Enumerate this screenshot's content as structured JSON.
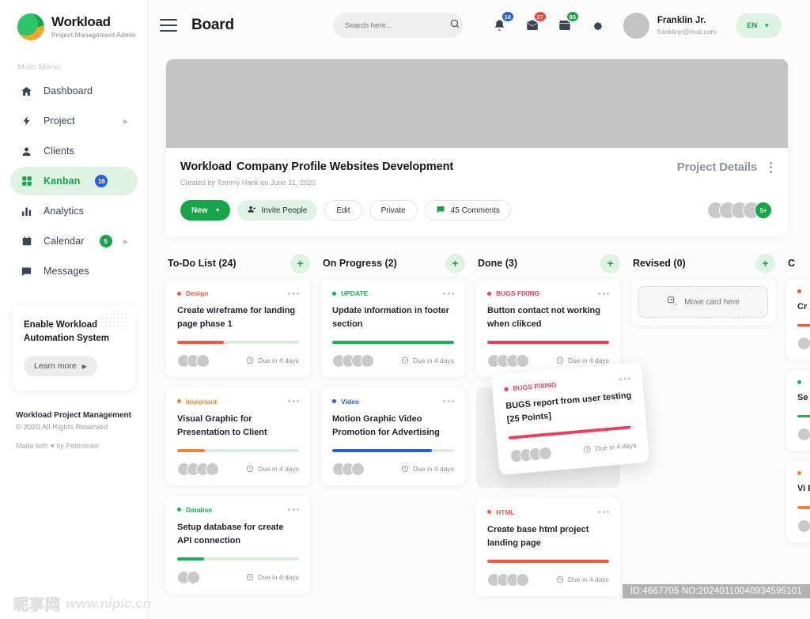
{
  "sidebar": {
    "brand": {
      "title": "Workload",
      "subtitle": "Project Management Admin",
      "logo_icon": "workload-logo"
    },
    "menu_label": "Main Menu",
    "items": [
      {
        "label": "Dashboard",
        "icon": "home-icon",
        "badge": null,
        "badge_color": null,
        "caret": false,
        "active": false
      },
      {
        "label": "Project",
        "icon": "bolt-icon",
        "badge": null,
        "badge_color": null,
        "caret": true,
        "active": false
      },
      {
        "label": "Clients",
        "icon": "user-icon",
        "badge": null,
        "badge_color": null,
        "caret": false,
        "active": false
      },
      {
        "label": "Kanban",
        "icon": "grid-icon",
        "badge": "16",
        "badge_color": "#2a5ed8",
        "caret": false,
        "active": true
      },
      {
        "label": "Analytics",
        "icon": "chart-icon",
        "badge": null,
        "badge_color": null,
        "caret": false,
        "active": false
      },
      {
        "label": "Calendar",
        "icon": "calendar-icon",
        "badge": "5",
        "badge_color": "#17a44a",
        "caret": true,
        "active": false
      },
      {
        "label": "Messages",
        "icon": "message-icon",
        "badge": null,
        "badge_color": null,
        "caret": false,
        "active": false
      }
    ],
    "promo": {
      "title": "Enable Workload Automation System",
      "button": "Learn more"
    },
    "footer": {
      "name": "Workload Project Management",
      "copyright": "© 2020 All Rights Reserved",
      "credit": "Made with ♥ by Peterdraw"
    }
  },
  "topbar": {
    "menu_icon": "hamburger-icon",
    "title": "Board",
    "search": {
      "placeholder": "Search here...",
      "value": "",
      "icon": "search-icon"
    },
    "icons": [
      {
        "name": "bell-icon",
        "badge": "16",
        "color": "#2a5ed8"
      },
      {
        "name": "mail-icon",
        "badge": "27",
        "color": "#f04438"
      },
      {
        "name": "inbox-icon",
        "badge": "83",
        "color": "#17a44a"
      }
    ],
    "settings_icon": "gear-icon",
    "user": {
      "name": "Franklin Jr.",
      "email": "franklinjr@mail.com",
      "avatar": "user-avatar"
    },
    "language": {
      "code": "EN",
      "caret_icon": "chevron-down-icon"
    }
  },
  "project": {
    "title_brand": "Workload",
    "title_rest": "Company Profile Websites Development",
    "created": "Created by Tommy Hank on June 31, 2020",
    "details_label": "Project Details",
    "more_icon": "kebab-vertical-icon",
    "actions": {
      "new": "New",
      "invite": "Invite People",
      "edit": "Edit",
      "private": "Private",
      "comments": "45 Comments"
    },
    "members": {
      "count": 4,
      "more_label": "5+"
    }
  },
  "board": {
    "columns": [
      {
        "title": "To-Do List (24)",
        "add_icon": "plus-icon",
        "cards": [
          {
            "tag": "Design",
            "tag_color": "#f4563f",
            "title": "Create wireframe for landing page phase 1",
            "progress": 38,
            "bar_color": "#f4563f",
            "avatars": 3,
            "due": "Due in 4 days"
          },
          {
            "tag": "Important",
            "tag_color": "#f58233",
            "title": "Visual Graphic for Presentation to Client",
            "progress": 23,
            "bar_color": "#f58233",
            "avatars": 4,
            "due": "Due in 4 days"
          },
          {
            "tag": "Databse",
            "tag_color": "#13b653",
            "title": "Setup database for create API connection",
            "progress": 22,
            "bar_color": "#13b653",
            "avatars": 2,
            "due": "Due in 4 days"
          }
        ]
      },
      {
        "title": "On Progress (2)",
        "add_icon": "plus-icon",
        "cards": [
          {
            "tag": "UPDATE",
            "tag_color": "#13b653",
            "title": "Update information in footer section",
            "progress": 100,
            "bar_color": "#13b653",
            "avatars": 4,
            "due": "Due in 4 days"
          },
          {
            "tag": "Video",
            "tag_color": "#2a5ed8",
            "title": "Motion Graphic Video Promotion for Advertising",
            "progress": 82,
            "bar_color": "#2a5ed8",
            "avatars": 3,
            "due": "Due in 4 days"
          }
        ]
      },
      {
        "title": "Done (3)",
        "add_icon": "plus-icon",
        "cards": [
          {
            "tag": "BUGS FIXING",
            "tag_color": "#f23b5a",
            "title": "Button contact not working when clikced",
            "progress": 100,
            "bar_color": "#f23b5a",
            "avatars": 4,
            "due": "Due in 4 days"
          },
          {
            "tag": "BUGS FIXING",
            "tag_color": "#f23b5a",
            "title": "BUGS report from user testing [25 Points]",
            "progress": 97,
            "bar_color": "#f23b5a",
            "avatars": 4,
            "due": "Due in 4 days",
            "dragging": true
          },
          {
            "tag": "HTML",
            "tag_color": "#f4563f",
            "title": "Create base html project landing page",
            "progress": 100,
            "bar_color": "#f4563f",
            "avatars": 4,
            "due": "Due in 4 days"
          }
        ]
      },
      {
        "title": "Revised (0)",
        "add_icon": "plus-icon",
        "dropzone": {
          "label": "Move card here",
          "icon": "move-card-icon"
        },
        "cards": []
      },
      {
        "title": "C",
        "add_icon": "plus-icon",
        "partial": true,
        "cards": [
          {
            "tag": "",
            "tag_color": "#f4563f",
            "title": "Cr po",
            "progress": 40,
            "bar_color": "#f4563f",
            "avatars": 1,
            "due": ""
          },
          {
            "tag": "",
            "tag_color": "#13b653",
            "title": "Se co",
            "progress": 40,
            "bar_color": "#13b653",
            "avatars": 1,
            "due": ""
          },
          {
            "tag": "",
            "tag_color": "#f58233",
            "title": "Vi Pr",
            "progress": 40,
            "bar_color": "#f58233",
            "avatars": 1,
            "due": ""
          }
        ]
      }
    ]
  },
  "watermark": {
    "cn": "昵享网",
    "site": "www.nipic.cn",
    "id": "ID:4667705 NO:20240110040934595101"
  },
  "colors": {
    "accent": "#17a44a",
    "accent_soft": "#dff3e4",
    "blue": "#2a5ed8",
    "red": "#f23b5a",
    "orange": "#f58233"
  }
}
